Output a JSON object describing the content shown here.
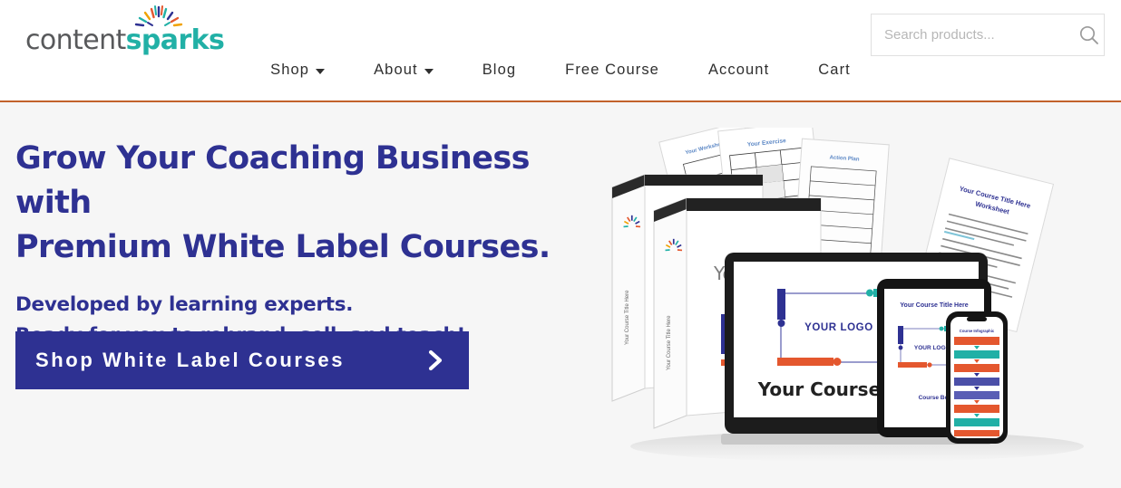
{
  "header": {
    "logo": {
      "part1": "content",
      "part2": "sparks",
      "burst_icon": "spark-burst-icon",
      "color1": "#58595b",
      "color2": "#21b0a6"
    },
    "search": {
      "placeholder": "Search products...",
      "value": "",
      "icon": "search-icon"
    },
    "nav": [
      {
        "label": "Shop",
        "has_dropdown": true
      },
      {
        "label": "About",
        "has_dropdown": true
      },
      {
        "label": "Blog",
        "has_dropdown": false
      },
      {
        "label": "Free Course",
        "has_dropdown": false
      },
      {
        "label": "Account",
        "has_dropdown": false
      },
      {
        "label": "Cart",
        "has_dropdown": false
      }
    ],
    "accent_border_color": "#c2622b"
  },
  "hero": {
    "headline_line1": "Grow Your Coaching Business with",
    "headline_line2": "Premium White Label Courses.",
    "subhead_line1": "Developed by learning experts.",
    "subhead_line2": "Ready for you to rebrand, sell, and teach!",
    "cta_label": "Shop White Label Courses",
    "cta_icon": "chevron-right-icon",
    "text_color": "#2e3192",
    "cta_bg_color": "#2e3192",
    "background_color": "#f6f6f6"
  },
  "mockup": {
    "alt": "white-label-course-product-bundle",
    "laptop_logo_text": "YOUR LOGO HERE",
    "laptop_title_text": "Your Course Title H",
    "tablet_title_text": "Your Course Title Here",
    "tablet_logo_text": "YOUR LOGO H",
    "tablet_footer_text": "Course Boo",
    "binder_cover_text": "Your",
    "binder_spine_text": "Your Course Title Here",
    "worksheet_title": "Your Course Title Here Worksheet",
    "accent_navy": "#2e3192",
    "accent_teal": "#21b0a6",
    "accent_orange": "#e4572e"
  }
}
